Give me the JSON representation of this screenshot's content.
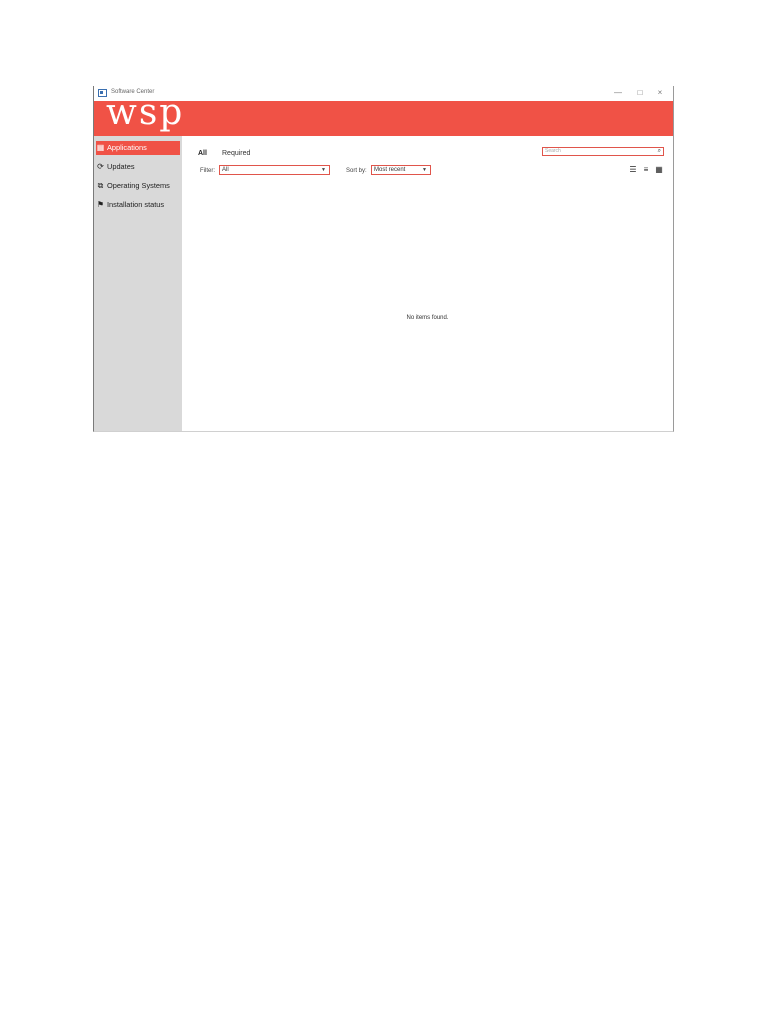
{
  "window": {
    "title": "Software Center",
    "controls": {
      "minimize": "—",
      "maximize": "□",
      "close": "×"
    }
  },
  "brand": {
    "logo_text": "wsp",
    "color": "#f05246"
  },
  "sidebar": {
    "items": [
      {
        "label": "Applications",
        "icon": "applications-icon",
        "active": true
      },
      {
        "label": "Updates",
        "icon": "refresh-icon",
        "active": false
      },
      {
        "label": "Operating Systems",
        "icon": "operating-systems-icon",
        "active": false
      },
      {
        "label": "Installation status",
        "icon": "flag-icon",
        "active": false
      }
    ]
  },
  "tabs": [
    {
      "label": "All",
      "selected": true
    },
    {
      "label": "Required",
      "selected": false
    }
  ],
  "filter": {
    "label": "Filter:",
    "value": "All"
  },
  "sort": {
    "label": "Sort by:",
    "value": "Most recent"
  },
  "search": {
    "placeholder": "Search"
  },
  "views": [
    "checklist-view-icon",
    "list-view-icon",
    "tile-view-icon"
  ],
  "empty_message": "No items found."
}
